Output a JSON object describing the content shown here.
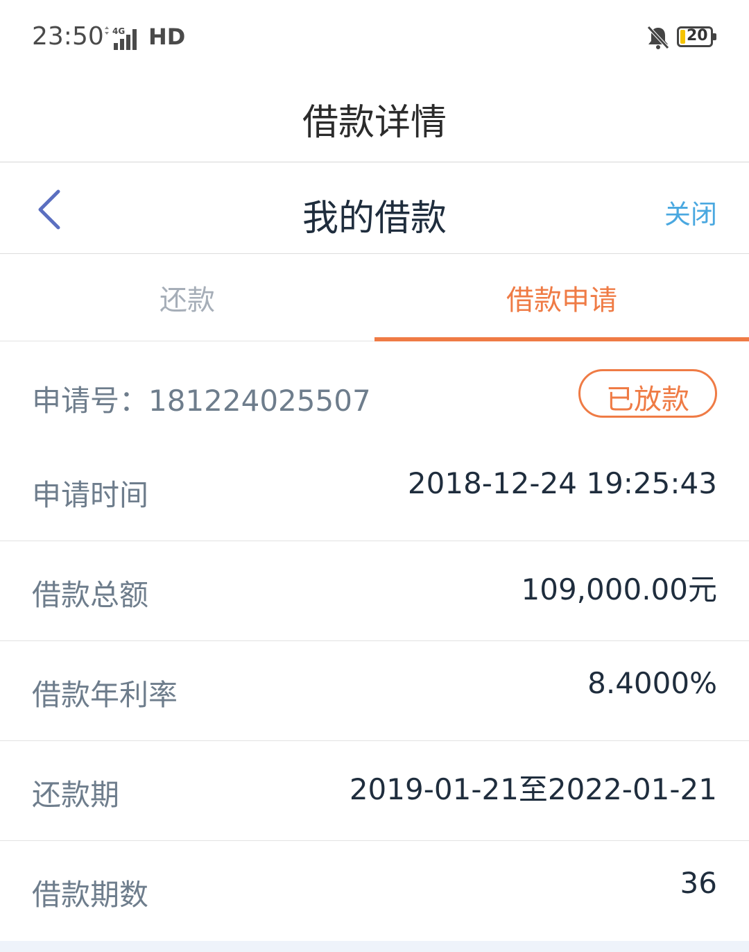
{
  "status_bar": {
    "time": "23:50",
    "network": "4G",
    "hd": "HD",
    "battery": "20",
    "icons": [
      "signal-icon",
      "bell-muted-icon",
      "battery-icon"
    ]
  },
  "header": {
    "title": "借款详情"
  },
  "nav": {
    "title": "我的借款",
    "close_label": "关闭",
    "back_icon": "chevron-left-icon",
    "accent_color": "#4aa8e0"
  },
  "tabs": [
    {
      "label": "还款",
      "active": false
    },
    {
      "label": "借款申请",
      "active": true
    }
  ],
  "colors": {
    "accent": "#ef7b45",
    "label": "#6e7d8c",
    "value": "#1f2d3d"
  },
  "application": {
    "label": "申请号：181224025507",
    "status": "已放款"
  },
  "details": [
    {
      "label": "申请时间",
      "value": "2018-12-24 19:25:43"
    },
    {
      "label": "借款总额",
      "value": "109,000.00元"
    },
    {
      "label": "借款年利率",
      "value": "8.4000%"
    },
    {
      "label": "还款期",
      "value": "2019-01-21至2022-01-21"
    },
    {
      "label": "借款期数",
      "value": "36"
    }
  ]
}
